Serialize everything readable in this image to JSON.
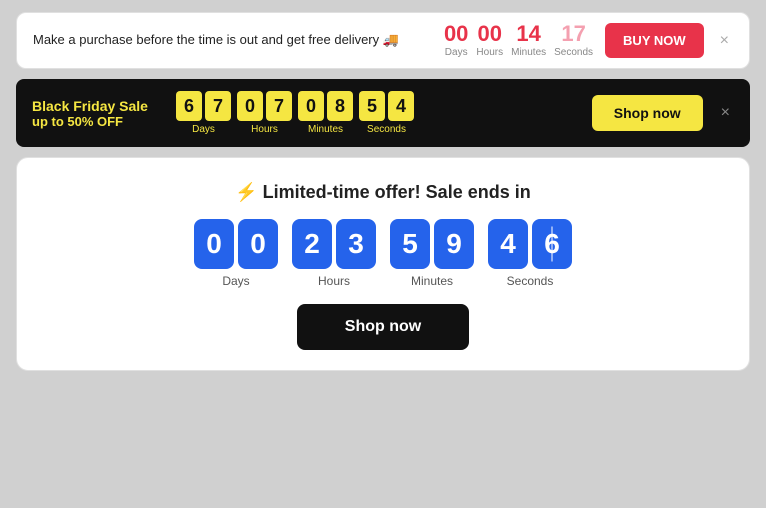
{
  "banner1": {
    "message": "Make a purchase before the time is out and get free delivery 🚚",
    "countdown": {
      "days": {
        "value": "00",
        "label": "Days"
      },
      "hours": {
        "value": "00",
        "label": "Hours"
      },
      "minutes": {
        "value": "14",
        "label": "Minutes"
      },
      "seconds": {
        "value": "17",
        "label": "Seconds"
      }
    },
    "buy_button": "BUY NOW",
    "close": "×"
  },
  "banner2": {
    "line1": "Black Friday Sale",
    "line2": "up to 50% OFF",
    "countdown": {
      "days": {
        "d1": "6",
        "d2": "7",
        "label": "Days"
      },
      "hours": {
        "d1": "0",
        "d2": "7",
        "label": "Hours"
      },
      "minutes": {
        "d1": "0",
        "d2": "8",
        "label": "Minutes"
      },
      "seconds": {
        "d1": "5",
        "d2": "4",
        "label": "Seconds"
      }
    },
    "shop_button": "Shop now",
    "close": "×"
  },
  "banner3": {
    "title": "⚡ Limited-time offer! Sale ends in",
    "countdown": {
      "days": {
        "d1": "0",
        "d2": "0",
        "label": "Days"
      },
      "hours": {
        "d1": "2",
        "d2": "3",
        "label": "Hours"
      },
      "minutes": {
        "d1": "5",
        "d2": "9",
        "label": "Minutes"
      },
      "seconds": {
        "d1": "4",
        "d2": "6",
        "label": "Seconds"
      }
    },
    "shop_button": "Shop now"
  }
}
